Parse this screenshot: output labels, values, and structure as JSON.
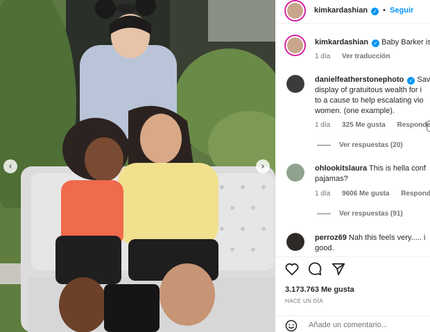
{
  "post": {
    "author": "kimkardashian",
    "follow_label": "Seguir",
    "separator": "•",
    "caption": {
      "username": "kimkardashian",
      "text": "Baby Barker is",
      "time": "1 día",
      "translate_label": "Ver traducción"
    }
  },
  "carousel": {
    "prev_icon": "chevron-left-icon",
    "next_icon": "chevron-right-icon",
    "prev_glyph": "‹",
    "next_glyph": "›"
  },
  "comments": [
    {
      "username": "danielfeatherstonephoto",
      "verified": true,
      "lines": [
        "danielfeatherstonephoto Sav",
        "display of gratuitous wealth for i",
        "to a cause to help escalating vio",
        "women. (one example)."
      ],
      "time": "1 día",
      "likes": "325 Me gusta",
      "reply_label": "Responder",
      "view_replies": "Ver respuestas (20)"
    },
    {
      "username": "ohlookitslaura",
      "verified": false,
      "lines": [
        "ohlookitslaura This is hella conf",
        "pajamas?"
      ],
      "time": "1 día",
      "likes": "9606 Me gusta",
      "reply_label": "Responder",
      "view_replies": "Ver respuestas (91)"
    },
    {
      "username": "perroz69",
      "verified": false,
      "lines": [
        "perroz69 Nah this feels very..... i",
        "good."
      ]
    }
  ],
  "actions": {
    "like_icon": "heart-icon",
    "comment_icon": "comment-icon",
    "share_icon": "share-icon",
    "likes_count": "3.173.763 Me gusta",
    "posted": "HACE UN DÍA"
  },
  "add_comment": {
    "emoji_icon": "emoji-icon",
    "placeholder": "Añade un comentario..."
  },
  "colors": {
    "link_blue": "#0095f6",
    "muted": "#737373",
    "text": "#262626",
    "border": "#efefef",
    "story_ring": "#d6249f"
  }
}
